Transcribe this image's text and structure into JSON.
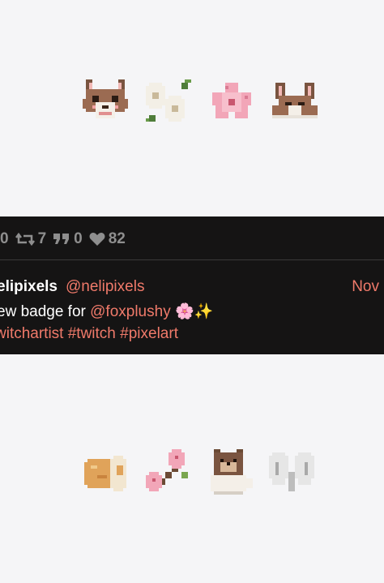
{
  "stats": {
    "replies": "0",
    "retweets": "7",
    "quotes": "0",
    "likes": "82"
  },
  "icons": {
    "retweet": "retweet-icon",
    "quote": "quote-icon",
    "like": "heart-icon"
  },
  "tweet": {
    "display_name": "elipixels",
    "handle": "@nelipixels",
    "date": "Nov",
    "text_prefix": "ew badge for",
    "mention": "@foxplushy",
    "emoji_blossom": "🌸",
    "emoji_sparkles": "✨",
    "hashtags": "witchartist #twitch #pixelart"
  },
  "top_emotes": [
    "fox-face-emote",
    "white-flowers-emote",
    "cherry-blossom-emote",
    "fox-ears-emote"
  ],
  "bottom_emotes": [
    "swiss-roll-emote",
    "blossom-branch-emote",
    "bear-mug-emote",
    "wings-emote"
  ],
  "colors": {
    "accent": "#f07a6a",
    "dark_bg": "#151414",
    "light_bg": "#f5f5f7"
  }
}
